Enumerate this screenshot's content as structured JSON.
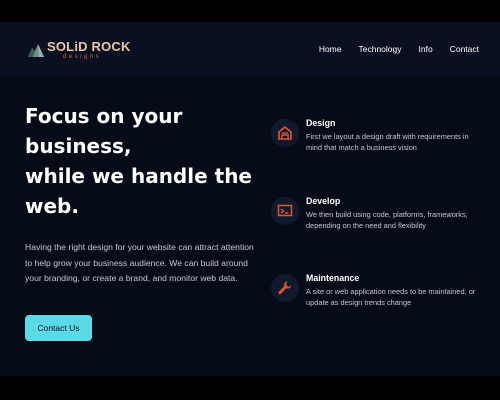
{
  "brand": {
    "name": "SOLiD ROCK",
    "tagline": "designs"
  },
  "nav": {
    "items": [
      "Home",
      "Technology",
      "Info",
      "Contact"
    ]
  },
  "hero": {
    "headline_1": "Focus on your",
    "headline_2": "business,",
    "headline_3": "while we handle the",
    "headline_4": "web.",
    "intro": "Having the right design for your website can attract attention to help grow your business audience. We can build around your branding, or create a brand, and monitor web data.",
    "cta_label": "Contact Us"
  },
  "features": [
    {
      "title": "Design",
      "description": "First we layout a design draft with requirements in mind that match a business vision",
      "icon": "layout-icon"
    },
    {
      "title": "Develop",
      "description": "We then build using code, platforms, frameworks, depending on the need and flexibility",
      "icon": "terminal-icon"
    },
    {
      "title": "Maintenance",
      "description": "A site or web application needs to be maintained, or update as design trends change",
      "icon": "wrench-icon"
    }
  ],
  "colors": {
    "background": "#060b18",
    "header": "#0a1022",
    "accent_cyan": "#5ad9e6",
    "accent_orange": "#e5532a"
  }
}
